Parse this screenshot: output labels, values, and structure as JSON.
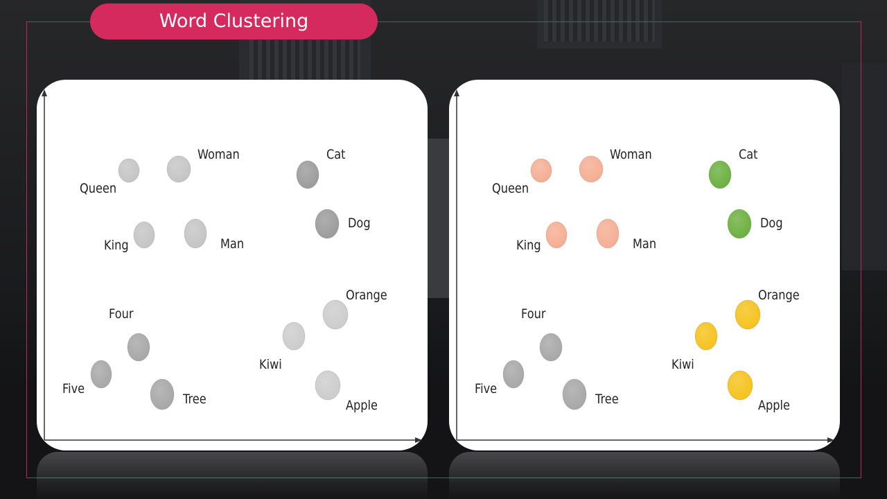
{
  "title": "Word Clustering",
  "colors": {
    "accent": "#d42a5e",
    "gray_light": "#c4c4c4",
    "gray_dark": "#9a9a9a",
    "salmon": "#f4ad91",
    "green": "#6aaf3d",
    "yellow": "#f5c21a"
  },
  "panels": [
    {
      "id": "left",
      "words": [
        {
          "label": "Queen",
          "color": "#c4c4c4"
        },
        {
          "label": "Woman",
          "color": "#c4c4c4"
        },
        {
          "label": "King",
          "color": "#c4c4c4"
        },
        {
          "label": "Man",
          "color": "#c4c4c4"
        },
        {
          "label": "Cat",
          "color": "#9a9a9a"
        },
        {
          "label": "Dog",
          "color": "#9a9a9a"
        },
        {
          "label": "Four",
          "color": "#a6a6a6"
        },
        {
          "label": "Five",
          "color": "#a6a6a6"
        },
        {
          "label": "Tree",
          "color": "#a6a6a6"
        },
        {
          "label": "Orange",
          "color": "#cccccc"
        },
        {
          "label": "Kiwi",
          "color": "#cccccc"
        },
        {
          "label": "Apple",
          "color": "#cccccc"
        }
      ]
    },
    {
      "id": "right",
      "words": [
        {
          "label": "Queen",
          "color": "#f4ad91"
        },
        {
          "label": "Woman",
          "color": "#f4ad91"
        },
        {
          "label": "King",
          "color": "#f4ad91"
        },
        {
          "label": "Man",
          "color": "#f4ad91"
        },
        {
          "label": "Cat",
          "color": "#6aaf3d"
        },
        {
          "label": "Dog",
          "color": "#6aaf3d"
        },
        {
          "label": "Four",
          "color": "#a6a6a6"
        },
        {
          "label": "Five",
          "color": "#a6a6a6"
        },
        {
          "label": "Tree",
          "color": "#a6a6a6"
        },
        {
          "label": "Orange",
          "color": "#f5c21a"
        },
        {
          "label": "Kiwi",
          "color": "#f5c21a"
        },
        {
          "label": "Apple",
          "color": "#f5c21a"
        }
      ]
    }
  ]
}
